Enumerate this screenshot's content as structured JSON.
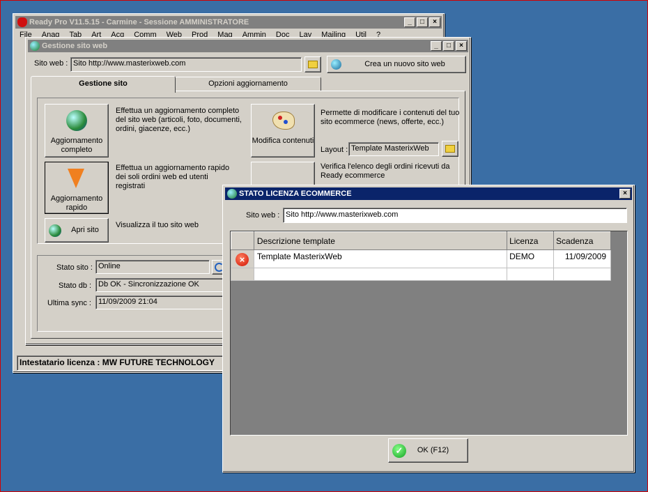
{
  "main": {
    "title": "Ready Pro V11.5.15 - Carmine - Sessione AMMINISTRATORE",
    "menu": [
      "File",
      "Anag",
      "Tab",
      "Art",
      "Acq",
      "Comm",
      "Web",
      "Prod",
      "Mag",
      "Ammin",
      "Doc",
      "Lav",
      "Mailing",
      "Util",
      "?"
    ],
    "status_bar": "Intestatario licenza : MW FUTURE TECHNOLOGY"
  },
  "gestione": {
    "title": "Gestione sito web",
    "site_label": "Sito web :",
    "site_value": "Sito http://www.masterixweb.com",
    "new_site_button": "Crea un nuovo sito web",
    "tabs": [
      "Gestione sito",
      "Opzioni aggiornamento"
    ],
    "btn_full": "Aggiornamento completo",
    "desc_full": "Effettua un aggiornamento completo del sito web (articoli, foto, documenti, ordini, giacenze, ecc.)",
    "btn_quick": "Aggiornamento rapido",
    "desc_quick": "Effettua un aggiornamento rapido dei soli ordini web ed utenti registrati",
    "btn_open": "Apri sito",
    "desc_open": "Visualizza il tuo sito web",
    "btn_edit": "Modifica contenuti",
    "desc_edit": "Permette di modificare i contenuti del tuo sito ecommerce (news, offerte, ecc.)",
    "layout_label": "Layout :",
    "layout_value": "Template MasterixWeb",
    "desc_orders": "Verifica l'elenco degli ordini ricevuti da Ready ecommerce",
    "stato_sito_label": "Stato sito :",
    "stato_sito_value": "Online",
    "stato_db_label": "Stato db :",
    "stato_db_value": "Db OK - Sincronizzazione OK",
    "ultima_sync_label": "Ultima sync :",
    "ultima_sync_value": "11/09/2009 21:04"
  },
  "licenza": {
    "title": "STATO LICENZA ECOMMERCE",
    "site_label": "Sito web :",
    "site_value": "Sito http://www.masterixweb.com",
    "columns": [
      "Descrizione template",
      "Licenza",
      "Scadenza"
    ],
    "rows": [
      {
        "descr": "Template MasterixWeb",
        "licenza": "DEMO",
        "scadenza": "11/09/2009"
      }
    ],
    "ok_button": "OK (F12)"
  },
  "colors": {
    "titlebar_active": "#0a246a",
    "titlebar_inactive": "#808080",
    "desktop": "#3a6ea5",
    "face": "#d4d0c8",
    "grid_empty": "#808080"
  }
}
